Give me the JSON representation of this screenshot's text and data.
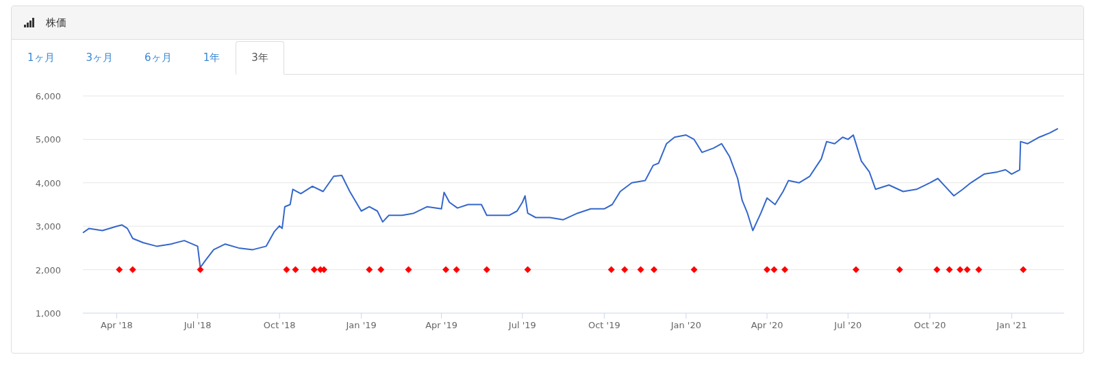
{
  "panel": {
    "title": "株価"
  },
  "tabs": [
    {
      "label": "1ヶ月",
      "selected": false
    },
    {
      "label": "3ヶ月",
      "selected": false
    },
    {
      "label": "6ヶ月",
      "selected": false
    },
    {
      "label": "1年",
      "selected": false
    },
    {
      "label": "3年",
      "selected": true
    }
  ],
  "chart_data": {
    "type": "line",
    "grid": true,
    "xlim": [
      "2018-02-22",
      "2021-03-01"
    ],
    "ylim": [
      1000,
      6000
    ],
    "yticks": [
      {
        "value": 1000,
        "label": "1,000"
      },
      {
        "value": 2000,
        "label": "2,000"
      },
      {
        "value": 3000,
        "label": "3,000"
      },
      {
        "value": 4000,
        "label": "4,000"
      },
      {
        "value": 5000,
        "label": "5,000"
      },
      {
        "value": 6000,
        "label": "6,000"
      }
    ],
    "xticks": [
      {
        "value": "2018-04-01",
        "label": "Apr '18"
      },
      {
        "value": "2018-07-01",
        "label": "Jul '18"
      },
      {
        "value": "2018-10-01",
        "label": "Oct '18"
      },
      {
        "value": "2019-01-01",
        "label": "Jan '19"
      },
      {
        "value": "2019-04-01",
        "label": "Apr '19"
      },
      {
        "value": "2019-07-01",
        "label": "Jul '19"
      },
      {
        "value": "2019-10-01",
        "label": "Oct '19"
      },
      {
        "value": "2020-01-01",
        "label": "Jan '20"
      },
      {
        "value": "2020-04-01",
        "label": "Apr '20"
      },
      {
        "value": "2020-07-01",
        "label": "Jul '20"
      },
      {
        "value": "2020-10-01",
        "label": "Oct '20"
      },
      {
        "value": "2021-01-01",
        "label": "Jan '21"
      }
    ],
    "series": [
      {
        "type": "line",
        "color": "#3366cc",
        "x": [
          "2018-02-22",
          "2018-03-01",
          "2018-03-16",
          "2018-04-01",
          "2018-04-07",
          "2018-04-13",
          "2018-04-19",
          "2018-05-01",
          "2018-05-16",
          "2018-06-01",
          "2018-06-16",
          "2018-07-01",
          "2018-07-04",
          "2018-07-10",
          "2018-07-19",
          "2018-08-01",
          "2018-08-16",
          "2018-09-01",
          "2018-09-16",
          "2018-09-25",
          "2018-10-01",
          "2018-10-04",
          "2018-10-07",
          "2018-10-13",
          "2018-10-16",
          "2018-10-25",
          "2018-11-07",
          "2018-11-19",
          "2018-12-01",
          "2018-12-10",
          "2018-12-19",
          "2019-01-01",
          "2019-01-10",
          "2019-01-19",
          "2019-01-25",
          "2019-02-01",
          "2019-02-16",
          "2019-03-01",
          "2019-03-16",
          "2019-04-01",
          "2019-04-04",
          "2019-04-10",
          "2019-04-19",
          "2019-05-01",
          "2019-05-16",
          "2019-05-22",
          "2019-06-01",
          "2019-06-16",
          "2019-06-25",
          "2019-07-01",
          "2019-07-04",
          "2019-07-07",
          "2019-07-16",
          "2019-08-01",
          "2019-08-16",
          "2019-09-01",
          "2019-09-16",
          "2019-10-01",
          "2019-10-10",
          "2019-10-19",
          "2019-11-01",
          "2019-11-16",
          "2019-11-25",
          "2019-12-01",
          "2019-12-10",
          "2019-12-19",
          "2020-01-01",
          "2020-01-10",
          "2020-01-19",
          "2020-02-01",
          "2020-02-10",
          "2020-02-19",
          "2020-02-28",
          "2020-03-04",
          "2020-03-10",
          "2020-03-16",
          "2020-03-25",
          "2020-04-01",
          "2020-04-10",
          "2020-04-19",
          "2020-04-25",
          "2020-05-07",
          "2020-05-19",
          "2020-06-01",
          "2020-06-07",
          "2020-06-16",
          "2020-06-25",
          "2020-07-01",
          "2020-07-07",
          "2020-07-16",
          "2020-07-25",
          "2020-08-01",
          "2020-08-16",
          "2020-09-01",
          "2020-09-16",
          "2020-10-01",
          "2020-10-10",
          "2020-10-19",
          "2020-10-28",
          "2020-11-07",
          "2020-11-16",
          "2020-12-01",
          "2020-12-16",
          "2020-12-25",
          "2021-01-01",
          "2021-01-10",
          "2021-01-11",
          "2021-01-19",
          "2021-02-01",
          "2021-02-13",
          "2021-02-22"
        ],
        "values": [
          2850,
          2950,
          2900,
          3000,
          3030,
          2950,
          2720,
          2620,
          2540,
          2590,
          2670,
          2540,
          2050,
          2220,
          2460,
          2590,
          2500,
          2460,
          2540,
          2870,
          3010,
          2950,
          3450,
          3500,
          3850,
          3750,
          3920,
          3800,
          4150,
          4170,
          3800,
          3350,
          3450,
          3350,
          3100,
          3250,
          3250,
          3300,
          3450,
          3400,
          3780,
          3550,
          3420,
          3500,
          3500,
          3250,
          3250,
          3250,
          3350,
          3550,
          3700,
          3300,
          3200,
          3200,
          3150,
          3300,
          3400,
          3400,
          3500,
          3800,
          4000,
          4050,
          4400,
          4450,
          4900,
          5050,
          5100,
          5000,
          4700,
          4800,
          4900,
          4600,
          4100,
          3600,
          3300,
          2900,
          3300,
          3650,
          3500,
          3800,
          4050,
          4000,
          4150,
          4550,
          4950,
          4900,
          5050,
          5000,
          5100,
          4500,
          4250,
          3850,
          3950,
          3800,
          3850,
          4000,
          4100,
          3900,
          3700,
          3850,
          4000,
          4200,
          4250,
          4300,
          4200,
          4300,
          4950,
          4900,
          5050,
          5150,
          5250
        ]
      },
      {
        "type": "scatter",
        "color": "#ff0000",
        "x": [
          "2018-04-04",
          "2018-04-19",
          "2018-07-04",
          "2018-10-09",
          "2018-10-19",
          "2018-11-09",
          "2018-11-16",
          "2018-11-20",
          "2019-01-10",
          "2019-01-23",
          "2019-02-23",
          "2019-04-06",
          "2019-04-18",
          "2019-05-22",
          "2019-07-07",
          "2019-10-09",
          "2019-10-24",
          "2019-11-11",
          "2019-11-26",
          "2020-01-10",
          "2020-04-01",
          "2020-04-09",
          "2020-04-21",
          "2020-07-10",
          "2020-08-28",
          "2020-10-09",
          "2020-10-23",
          "2020-11-04",
          "2020-11-12",
          "2020-11-25",
          "2021-01-14"
        ],
        "values": [
          2000,
          2000,
          2000,
          2000,
          2000,
          2000,
          2000,
          2000,
          2000,
          2000,
          2000,
          2000,
          2000,
          2000,
          2000,
          2000,
          2000,
          2000,
          2000,
          2000,
          2000,
          2000,
          2000,
          2000,
          2000,
          2000,
          2000,
          2000,
          2000,
          2000,
          2000
        ]
      }
    ]
  }
}
